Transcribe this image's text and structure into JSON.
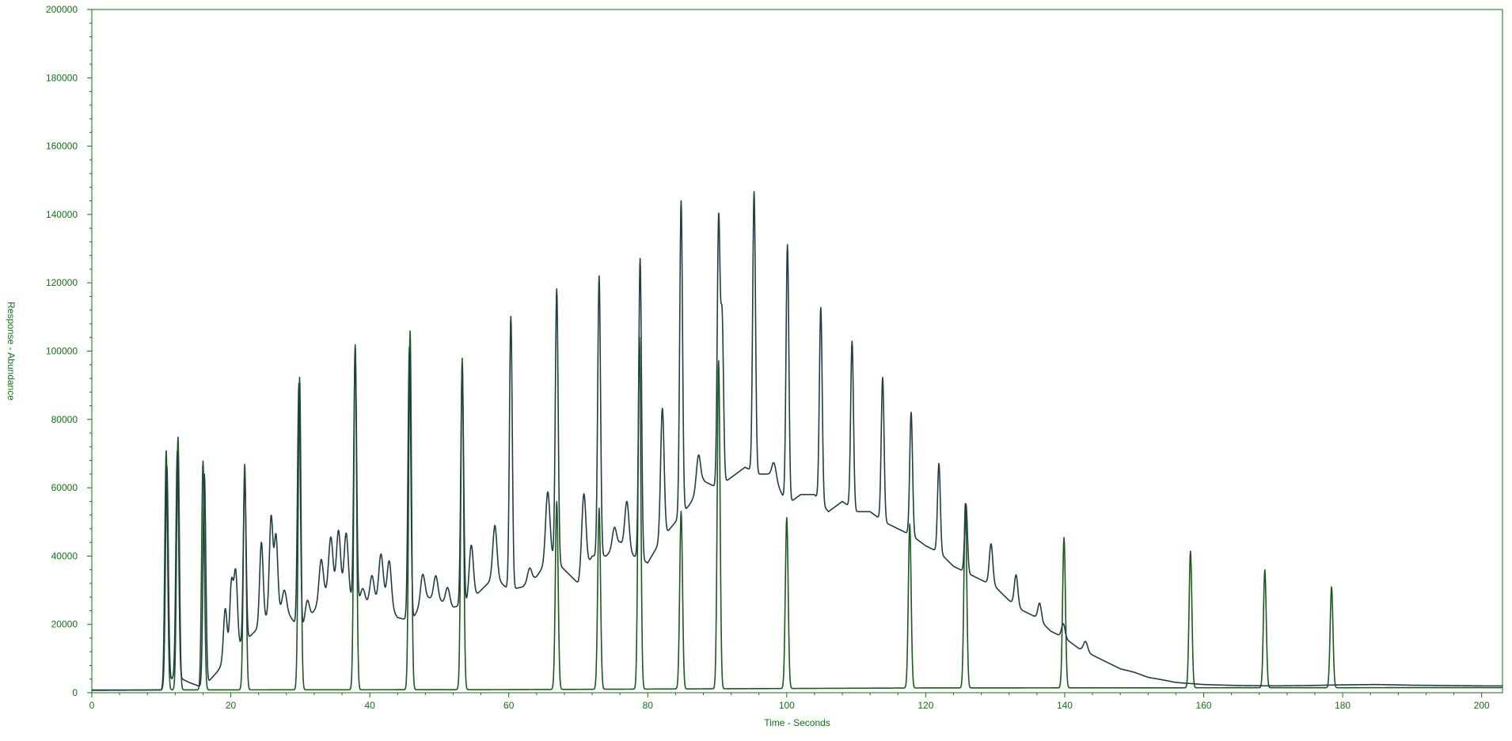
{
  "chart_data": {
    "type": "line",
    "title": "",
    "xlabel": "Time - Seconds",
    "ylabel": "Response - Abundance",
    "xlim": [
      0,
      203
    ],
    "ylim": [
      0,
      200000
    ],
    "x_ticks": [
      0,
      20,
      40,
      60,
      80,
      100,
      120,
      140,
      160,
      180,
      200
    ],
    "y_ticks": [
      0,
      20000,
      40000,
      60000,
      80000,
      100000,
      120000,
      140000,
      160000,
      180000,
      200000
    ],
    "grid": false,
    "colors": {
      "axis": "#0a7a0a",
      "trace_sample": "#1f3f44",
      "trace_standard": "#1a5a1a"
    },
    "series": [
      {
        "baseline": [
          [
            0,
            800
          ],
          [
            60,
            900
          ],
          [
            120,
            1400
          ],
          [
            203,
            1500
          ]
        ],
        "peaks": [
          [
            10.7,
            70000,
            0.2
          ],
          [
            12.4,
            74000,
            0.2
          ],
          [
            16.0,
            67000,
            0.2
          ],
          [
            22.0,
            66000,
            0.2
          ],
          [
            29.9,
            91500,
            0.2
          ],
          [
            37.9,
            101000,
            0.2
          ],
          [
            45.8,
            105000,
            0.2
          ],
          [
            53.3,
            97000,
            0.2
          ],
          [
            66.9,
            55000,
            0.2
          ],
          [
            73.0,
            53000,
            0.2
          ],
          [
            78.8,
            103000,
            0.2
          ],
          [
            84.8,
            52000,
            0.2
          ],
          [
            90.2,
            96000,
            0.2
          ],
          [
            100.0,
            50000,
            0.2
          ],
          [
            117.7,
            48000,
            0.2
          ],
          [
            125.7,
            54000,
            0.2
          ],
          [
            139.9,
            44000,
            0.2
          ],
          [
            158.1,
            40000,
            0.2
          ],
          [
            168.8,
            34500,
            0.2
          ],
          [
            178.4,
            29500,
            0.2
          ]
        ]
      },
      {
        "baseline": [
          [
            0,
            700
          ],
          [
            10,
            800
          ],
          [
            12,
            5000
          ],
          [
            14,
            3000
          ],
          [
            16,
            1500
          ],
          [
            18,
            6000
          ],
          [
            20,
            12000
          ],
          [
            22,
            15000
          ],
          [
            24,
            19000
          ],
          [
            26,
            24000
          ],
          [
            28,
            24000
          ],
          [
            30,
            18000
          ],
          [
            32,
            24000
          ],
          [
            34,
            30000
          ],
          [
            36,
            28000
          ],
          [
            38,
            27000
          ],
          [
            40,
            26000
          ],
          [
            42,
            28000
          ],
          [
            44,
            22000
          ],
          [
            46,
            21000
          ],
          [
            48,
            28000
          ],
          [
            50,
            27000
          ],
          [
            52,
            25000
          ],
          [
            54,
            26000
          ],
          [
            56,
            30000
          ],
          [
            58,
            34000
          ],
          [
            60,
            30000
          ],
          [
            62,
            31000
          ],
          [
            64,
            34000
          ],
          [
            66,
            40000
          ],
          [
            68,
            36000
          ],
          [
            70,
            32000
          ],
          [
            72,
            40000
          ],
          [
            74,
            40000
          ],
          [
            76,
            44000
          ],
          [
            78,
            40000
          ],
          [
            80,
            38000
          ],
          [
            82,
            45000
          ],
          [
            84,
            50000
          ],
          [
            86,
            55000
          ],
          [
            88,
            62000
          ],
          [
            90,
            60000
          ],
          [
            92,
            63000
          ],
          [
            94,
            66000
          ],
          [
            96,
            64000
          ],
          [
            98,
            64000
          ],
          [
            100,
            55000
          ],
          [
            102,
            58000
          ],
          [
            104,
            58000
          ],
          [
            106,
            53000
          ],
          [
            108,
            56000
          ],
          [
            110,
            53000
          ],
          [
            112,
            53000
          ],
          [
            114,
            50000
          ],
          [
            116,
            48000
          ],
          [
            118,
            46000
          ],
          [
            120,
            43000
          ],
          [
            122,
            41000
          ],
          [
            124,
            37000
          ],
          [
            126,
            35000
          ],
          [
            128,
            33000
          ],
          [
            130,
            31000
          ],
          [
            132,
            27000
          ],
          [
            134,
            24000
          ],
          [
            136,
            22000
          ],
          [
            138,
            18000
          ],
          [
            140,
            16000
          ],
          [
            142,
            13000
          ],
          [
            144,
            11000
          ],
          [
            146,
            9000
          ],
          [
            148,
            7000
          ],
          [
            150,
            6000
          ],
          [
            152,
            4500
          ],
          [
            154,
            3800
          ],
          [
            156,
            3000
          ],
          [
            158,
            2700
          ],
          [
            160,
            2400
          ],
          [
            165,
            2100
          ],
          [
            170,
            2000
          ],
          [
            175,
            2100
          ],
          [
            180,
            2300
          ],
          [
            185,
            2400
          ],
          [
            190,
            2200
          ],
          [
            195,
            2100
          ],
          [
            200,
            2000
          ],
          [
            203,
            2000
          ]
        ],
        "peaks": [
          [
            10.8,
            64000,
            0.2
          ],
          [
            12.3,
            66000,
            0.2
          ],
          [
            16.2,
            62000,
            0.2
          ],
          [
            19.2,
            15000,
            0.25
          ],
          [
            20.1,
            20000,
            0.25
          ],
          [
            20.7,
            22000,
            0.25
          ],
          [
            22.0,
            48000,
            0.2
          ],
          [
            24.4,
            24000,
            0.25
          ],
          [
            25.8,
            28000,
            0.25
          ],
          [
            26.5,
            22000,
            0.25
          ],
          [
            27.7,
            6000,
            0.3
          ],
          [
            29.8,
            72000,
            0.2
          ],
          [
            31.0,
            6000,
            0.3
          ],
          [
            33.0,
            12000,
            0.3
          ],
          [
            34.4,
            16000,
            0.3
          ],
          [
            35.5,
            19000,
            0.3
          ],
          [
            36.6,
            19000,
            0.3
          ],
          [
            37.9,
            74000,
            0.2
          ],
          [
            39.0,
            4000,
            0.3
          ],
          [
            40.3,
            8000,
            0.3
          ],
          [
            41.6,
            13000,
            0.3
          ],
          [
            42.8,
            13000,
            0.3
          ],
          [
            45.7,
            80000,
            0.2
          ],
          [
            47.6,
            8000,
            0.3
          ],
          [
            49.5,
            7000,
            0.3
          ],
          [
            51.2,
            5000,
            0.3
          ],
          [
            53.3,
            70000,
            0.2
          ],
          [
            54.6,
            16000,
            0.3
          ],
          [
            58.0,
            15000,
            0.3
          ],
          [
            60.3,
            80000,
            0.2
          ],
          [
            63.0,
            4000,
            0.3
          ],
          [
            65.6,
            20000,
            0.3
          ],
          [
            66.9,
            80000,
            0.2
          ],
          [
            70.8,
            23000,
            0.3
          ],
          [
            73.0,
            82000,
            0.2
          ],
          [
            75.2,
            6000,
            0.3
          ],
          [
            77.0,
            14000,
            0.3
          ],
          [
            78.9,
            88000,
            0.2
          ],
          [
            82.1,
            38000,
            0.25
          ],
          [
            84.8,
            92000,
            0.2
          ],
          [
            87.3,
            10000,
            0.3
          ],
          [
            90.2,
            78000,
            0.2
          ],
          [
            90.7,
            48000,
            0.2
          ],
          [
            95.3,
            82000,
            0.2
          ],
          [
            98.2,
            4000,
            0.3
          ],
          [
            100.1,
            76000,
            0.2
          ],
          [
            104.9,
            57000,
            0.2
          ],
          [
            109.4,
            49000,
            0.2
          ],
          [
            113.8,
            42000,
            0.2
          ],
          [
            117.9,
            36000,
            0.2
          ],
          [
            121.9,
            26000,
            0.2
          ],
          [
            125.8,
            20000,
            0.2
          ],
          [
            129.4,
            12000,
            0.25
          ],
          [
            133.0,
            9000,
            0.25
          ],
          [
            136.4,
            5000,
            0.25
          ],
          [
            139.8,
            4000,
            0.25
          ],
          [
            143.0,
            3000,
            0.3
          ]
        ]
      }
    ]
  }
}
